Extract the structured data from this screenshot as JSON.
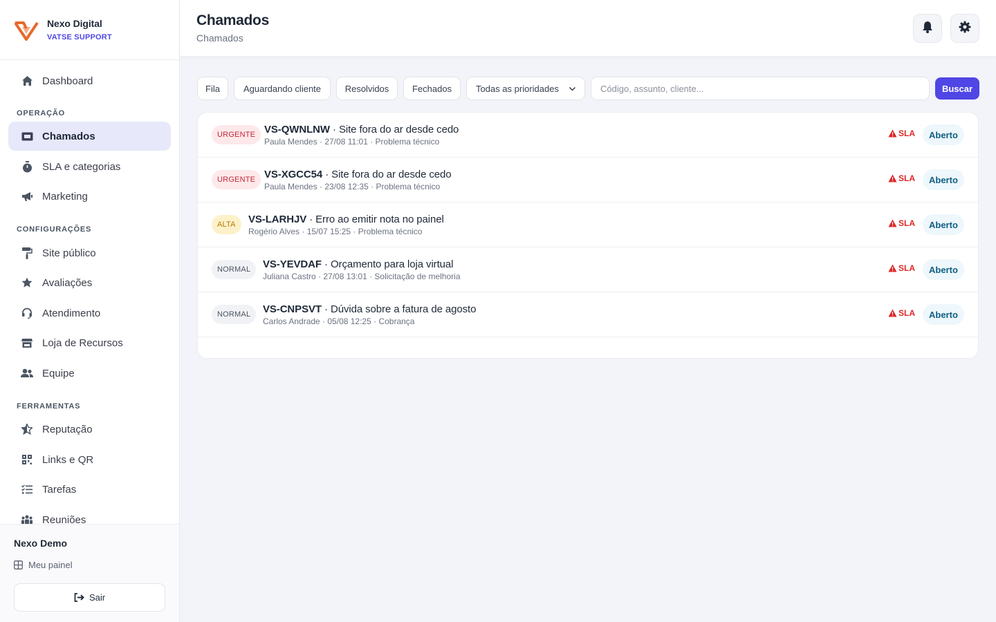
{
  "brand": {
    "name": "Nexo Digital",
    "subtitle": "VATSE SUPPORT"
  },
  "nav": {
    "top": [
      {
        "label": "Dashboard",
        "icon": "home-icon"
      }
    ],
    "sections": [
      {
        "title": "OPERAÇÃO",
        "items": [
          {
            "label": "Chamados",
            "icon": "ticket-icon",
            "active": true
          },
          {
            "label": "SLA e categorias",
            "icon": "stopwatch-icon"
          },
          {
            "label": "Marketing",
            "icon": "megaphone-icon"
          }
        ]
      },
      {
        "title": "CONFIGURAÇÕES",
        "items": [
          {
            "label": "Site público",
            "icon": "paint-roller-icon"
          },
          {
            "label": "Avaliações",
            "icon": "star-icon"
          },
          {
            "label": "Atendimento",
            "icon": "headset-icon"
          },
          {
            "label": "Loja de Recursos",
            "icon": "store-icon"
          },
          {
            "label": "Equipe",
            "icon": "users-icon"
          }
        ]
      },
      {
        "title": "FERRAMENTAS",
        "items": [
          {
            "label": "Reputação",
            "icon": "star-half-icon"
          },
          {
            "label": "Links e QR",
            "icon": "qrcode-icon"
          },
          {
            "label": "Tarefas",
            "icon": "checklist-icon"
          },
          {
            "label": "Reuniões",
            "icon": "people-group-icon"
          }
        ]
      }
    ]
  },
  "footer": {
    "user_name": "Nexo Demo",
    "my_panel": "Meu painel",
    "logout": "Sair"
  },
  "header": {
    "title": "Chamados",
    "subtitle": "Chamados"
  },
  "filters": {
    "tabs": [
      "Fila",
      "Aguardando cliente",
      "Resolvidos",
      "Fechados"
    ],
    "priority_select": "Todas as prioridades",
    "search_placeholder": "Código, assunto, cliente...",
    "search_button": "Buscar"
  },
  "tickets": [
    {
      "priority": "URGENTE",
      "code": "VS-QWNLNW",
      "subject": "Site fora do ar desde cedo",
      "meta": "Paula Mendes · 27/08 11:01 · Problema técnico",
      "sla": "SLA",
      "status": "Aberto"
    },
    {
      "priority": "URGENTE",
      "code": "VS-XGCC54",
      "subject": "Site fora do ar desde cedo",
      "meta": "Paula Mendes · 23/08 12:35 · Problema técnico",
      "sla": "SLA",
      "status": "Aberto"
    },
    {
      "priority": "ALTA",
      "code": "VS-LARHJV",
      "subject": "Erro ao emitir nota no painel",
      "meta": "Rogério Alves · 15/07 15:25 · Problema técnico",
      "sla": "SLA",
      "status": "Aberto"
    },
    {
      "priority": "NORMAL",
      "code": "VS-YEVDAF",
      "subject": "Orçamento para loja virtual",
      "meta": "Juliana Castro · 27/08 13:01 · Solicitação de melhoria",
      "sla": "SLA",
      "status": "Aberto"
    },
    {
      "priority": "NORMAL",
      "code": "VS-CNPSVT",
      "subject": "Dúvida sobre a fatura de agosto",
      "meta": "Carlos Andrade · 05/08 12:25 · Cobrança",
      "sla": "SLA",
      "status": "Aberto"
    }
  ],
  "colors": {
    "accent": "#4f46e5",
    "brand_logo": "#e8692a",
    "urgent": "#c3283a",
    "high": "#b77806",
    "sla": "#dc2626",
    "status": "#0f5f86"
  }
}
